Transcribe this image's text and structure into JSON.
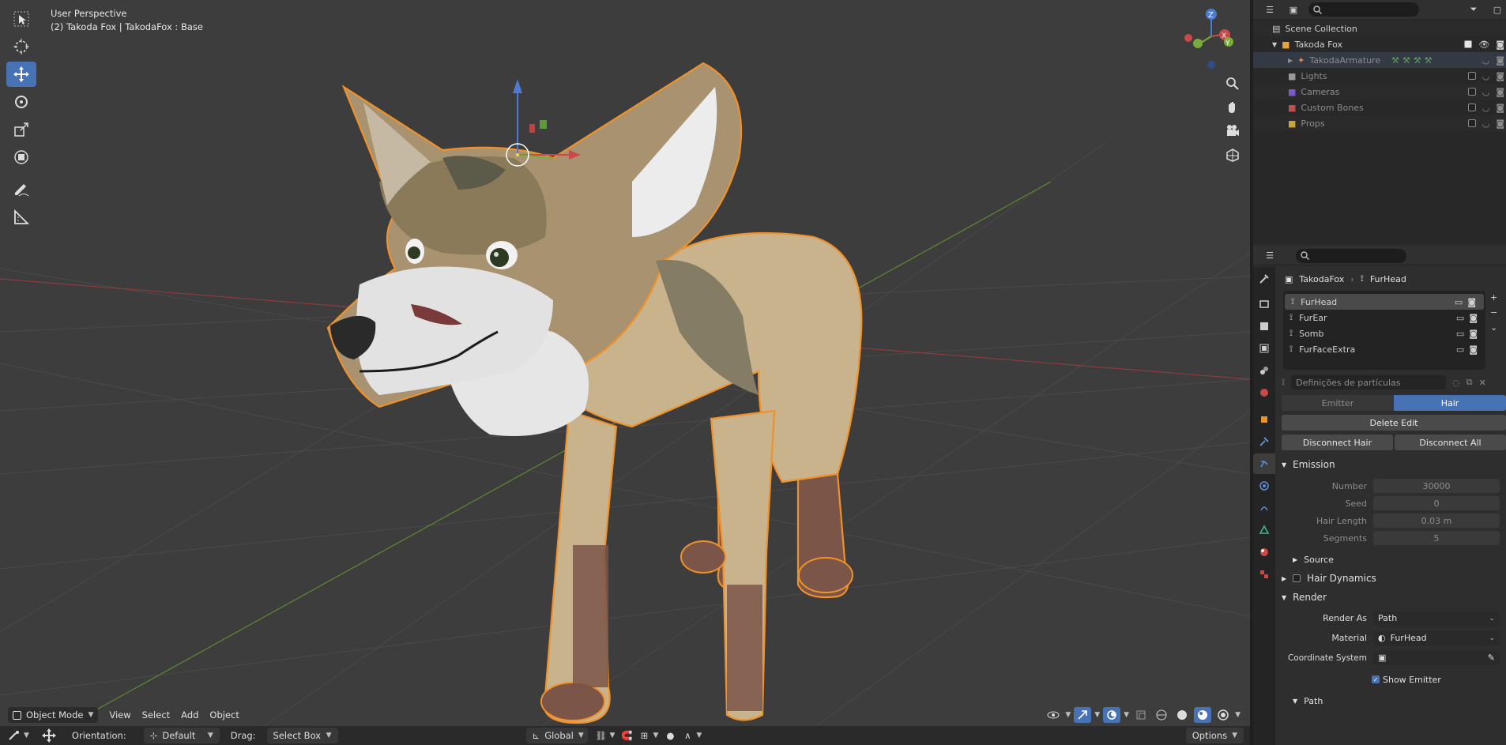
{
  "viewport": {
    "perspective": "User Perspective",
    "object_line": "(2) Takoda Fox | TakodaFox : Base"
  },
  "header_bottom": {
    "mode": "Object Mode",
    "menus": [
      "View",
      "Select",
      "Add",
      "Object"
    ]
  },
  "status_bar": {
    "orientation_label": "Orientation:",
    "orientation_value": "Default",
    "drag_label": "Drag:",
    "drag_value": "Select Box",
    "transform_space": "Global",
    "options": "Options"
  },
  "outliner": {
    "rows": [
      {
        "label": "Scene Collection"
      },
      {
        "label": "Takoda Fox"
      },
      {
        "label": "TakodaArmature"
      },
      {
        "label": "Lights"
      },
      {
        "label": "Cameras"
      },
      {
        "label": "Custom Bones"
      },
      {
        "label": "Props"
      }
    ]
  },
  "properties": {
    "breadcrumb_object": "TakodaFox",
    "breadcrumb_system": "FurHead",
    "particle_systems": [
      "FurHead",
      "FurEar",
      "Somb",
      "FurFaceExtra"
    ],
    "settings_placeholder": "Definições de partículas",
    "type_emitter": "Emitter",
    "type_hair": "Hair",
    "delete_edit": "Delete Edit",
    "disconnect_hair": "Disconnect Hair",
    "disconnect_all": "Disconnect All",
    "emission": {
      "title": "Emission",
      "number_label": "Number",
      "number_value": "30000",
      "seed_label": "Seed",
      "seed_value": "0",
      "hair_length_label": "Hair Length",
      "hair_length_value": "0.03 m",
      "segments_label": "Segments",
      "segments_value": "5",
      "source": "Source"
    },
    "hair_dynamics": "Hair Dynamics",
    "render": {
      "title": "Render",
      "render_as_label": "Render As",
      "render_as_value": "Path",
      "material_label": "Material",
      "material_value": "FurHead",
      "coord_label": "Coordinate System",
      "show_emitter": "Show Emitter",
      "path": "Path"
    }
  },
  "colors": {
    "accent": "#4772b3",
    "selection_outline": "#f0912a",
    "x_axis": "#c84a4a",
    "y_axis": "#7bab3a"
  }
}
